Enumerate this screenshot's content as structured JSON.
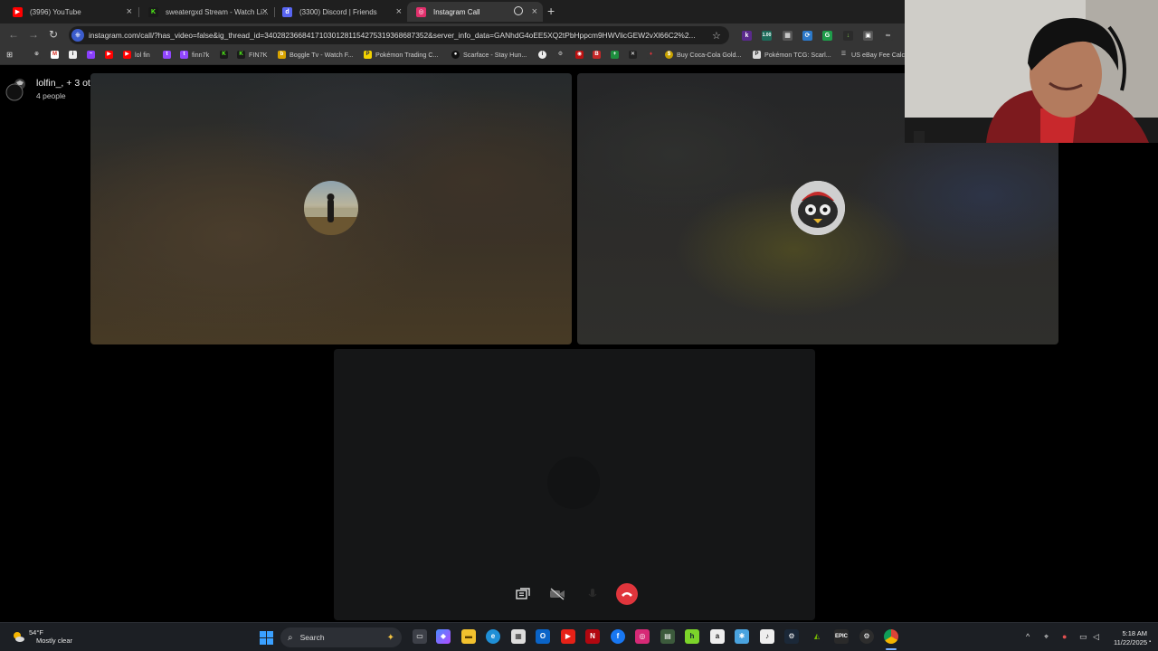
{
  "browser": {
    "tabs": [
      {
        "label": "(3996) YouTube",
        "icon": "youtube-icon",
        "color": "#ff0000"
      },
      {
        "label": "sweatergxd Stream - Watch Li...",
        "icon": "kick-icon",
        "color": "#53fc18"
      },
      {
        "label": "(3300) Discord | Friends",
        "icon": "discord-icon",
        "color": "#5865f2"
      },
      {
        "label": "Instagram Call",
        "icon": "instagram-icon",
        "color": "#e1306c"
      }
    ],
    "url": "instagram.com/call/?has_video=false&ig_thread_id=340282366841710301281154275319368687352&server_info_data=GANhdG4oEE5XQ2tPbHppcm9HWVlicGEW2vXl66C2%2...",
    "bookmarks": [
      "lol fin",
      "finn7k",
      "FIN7K",
      "Boggle Tv - Watch F...",
      "Pokémon Trading C...",
      "Scarface - Stay Hun...",
      "Buy Coca-Cola Gold...",
      "Pokémon TCG: Scarl...",
      "US eBay Fee Calc"
    ]
  },
  "call": {
    "title": "lolfin_, + 3 others",
    "subtitle": "4 people",
    "accent_end_call": "#e0353c"
  },
  "taskbar": {
    "weather_temp": "54°F",
    "weather_desc": "Mostly clear",
    "search_label": "Search",
    "time": "5:18 AM",
    "date": "11/22/2025"
  }
}
